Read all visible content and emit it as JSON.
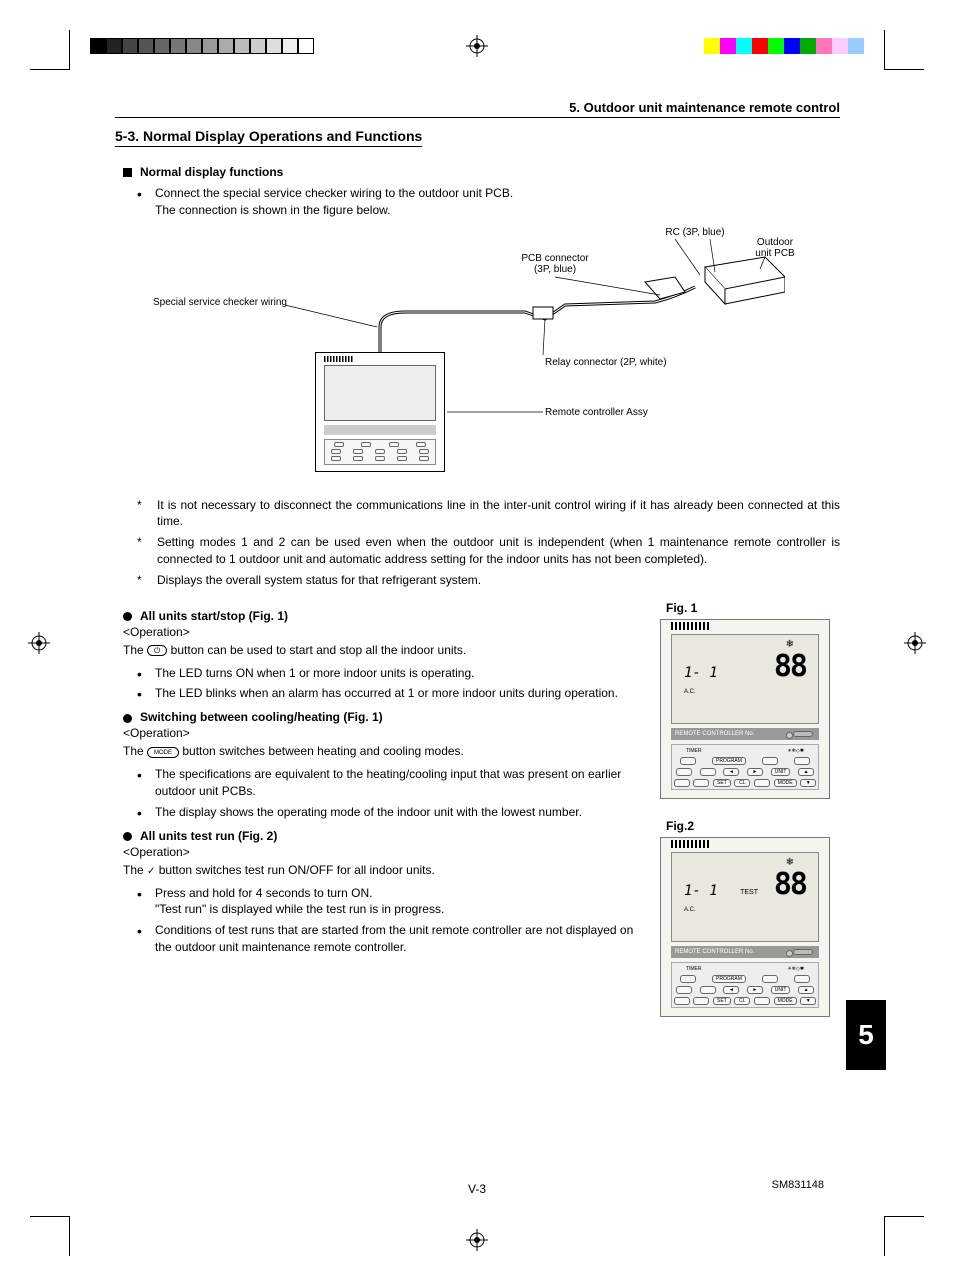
{
  "header_chapter": "5. Outdoor unit maintenance remote control",
  "section_title": "5-3. Normal Display Operations and Functions",
  "sub1_title": "Normal display functions",
  "sub1_bullets": [
    "Connect the special service checker wiring to the outdoor unit PCB.\nThe connection is shown in the figure below."
  ],
  "wiring_labels": {
    "checker": "Special service checker wiring",
    "pcb_connector": "PCB connector\n(3P, blue)",
    "rc": "RC (3P, blue)",
    "outdoor_pcb": "Outdoor\nunit PCB",
    "relay": "Relay connector (2P, white)",
    "assy": "Remote controller Assy"
  },
  "star_notes": [
    "It is not necessary to disconnect the communications line in the inter-unit control wiring if it has already been connected at this time.",
    "Setting modes 1 and 2 can be used even when the outdoor unit is independent (when 1 maintenance remote controller is connected to 1 outdoor unit and automatic address setting for the indoor units has not been completed).",
    "Displays the overall system status for that refrigerant system."
  ],
  "sub2_title": "All units start/stop (Fig. 1)",
  "op_label": "<Operation>",
  "sub2_text_pre": "The ",
  "sub2_btn": "⏻",
  "sub2_text_post": " button can be used to start and stop all the indoor units.",
  "sub2_bullets": [
    "The LED turns ON when 1 or more indoor units is operating.",
    "The LED blinks when an alarm has occurred at 1 or more indoor units during operation."
  ],
  "sub3_title": "Switching between cooling/heating (Fig. 1)",
  "sub3_text_pre": "The ",
  "sub3_btn": "MODE",
  "sub3_text_post": " button switches between heating and cooling modes.",
  "sub3_bullets": [
    "The specifications are equivalent to the heating/cooling input that was present on earlier outdoor unit PCBs.",
    "The display shows the operating mode of the indoor unit with the lowest number."
  ],
  "sub4_title": "All units test run (Fig. 2)",
  "sub4_text_pre": "The ",
  "sub4_btn": "✓",
  "sub4_text_post": " button switches test run ON/OFF for all indoor units.",
  "sub4_bullets": [
    "Press and hold for 4 seconds to turn ON.\n\"Test run\" is displayed while the test run is in progress.",
    "Conditions of test runs that are started from the unit remote controller are not displayed on the outdoor unit maintenance remote controller."
  ],
  "fig1_label": "Fig. 1",
  "fig2_label": "Fig.2",
  "remote": {
    "seg_small": "1- 1",
    "ac": "A.C.",
    "seg_big": "88",
    "snow": "❄",
    "rc_bar": "REMOTE CONTROLLER No.",
    "test": "TEST",
    "panel_labels": {
      "timer": "TIMER",
      "mode": "MODE",
      "sun": "☀❄◇✱",
      "program": "PROGRAM",
      "unit": "UNIT",
      "set": "SET",
      "cl": "CL",
      "mode2": "MODE",
      "left": "◄",
      "right": "►",
      "up": "▲",
      "down": "▼"
    }
  },
  "page_tab": "5",
  "footer_center": "V-3",
  "footer_right": "SM831148",
  "colors_left": [
    "#000",
    "#222",
    "#444",
    "#555",
    "#666",
    "#777",
    "#888",
    "#999",
    "#aaa",
    "#bbb",
    "#ccc",
    "#ddd",
    "#eee",
    "#fff"
  ],
  "colors_right": [
    "#ff0",
    "#f0f",
    "#0ff",
    "#f00",
    "#0f0",
    "#00f",
    "#0a0",
    "#f7b",
    "#fcf",
    "#9cf"
  ]
}
